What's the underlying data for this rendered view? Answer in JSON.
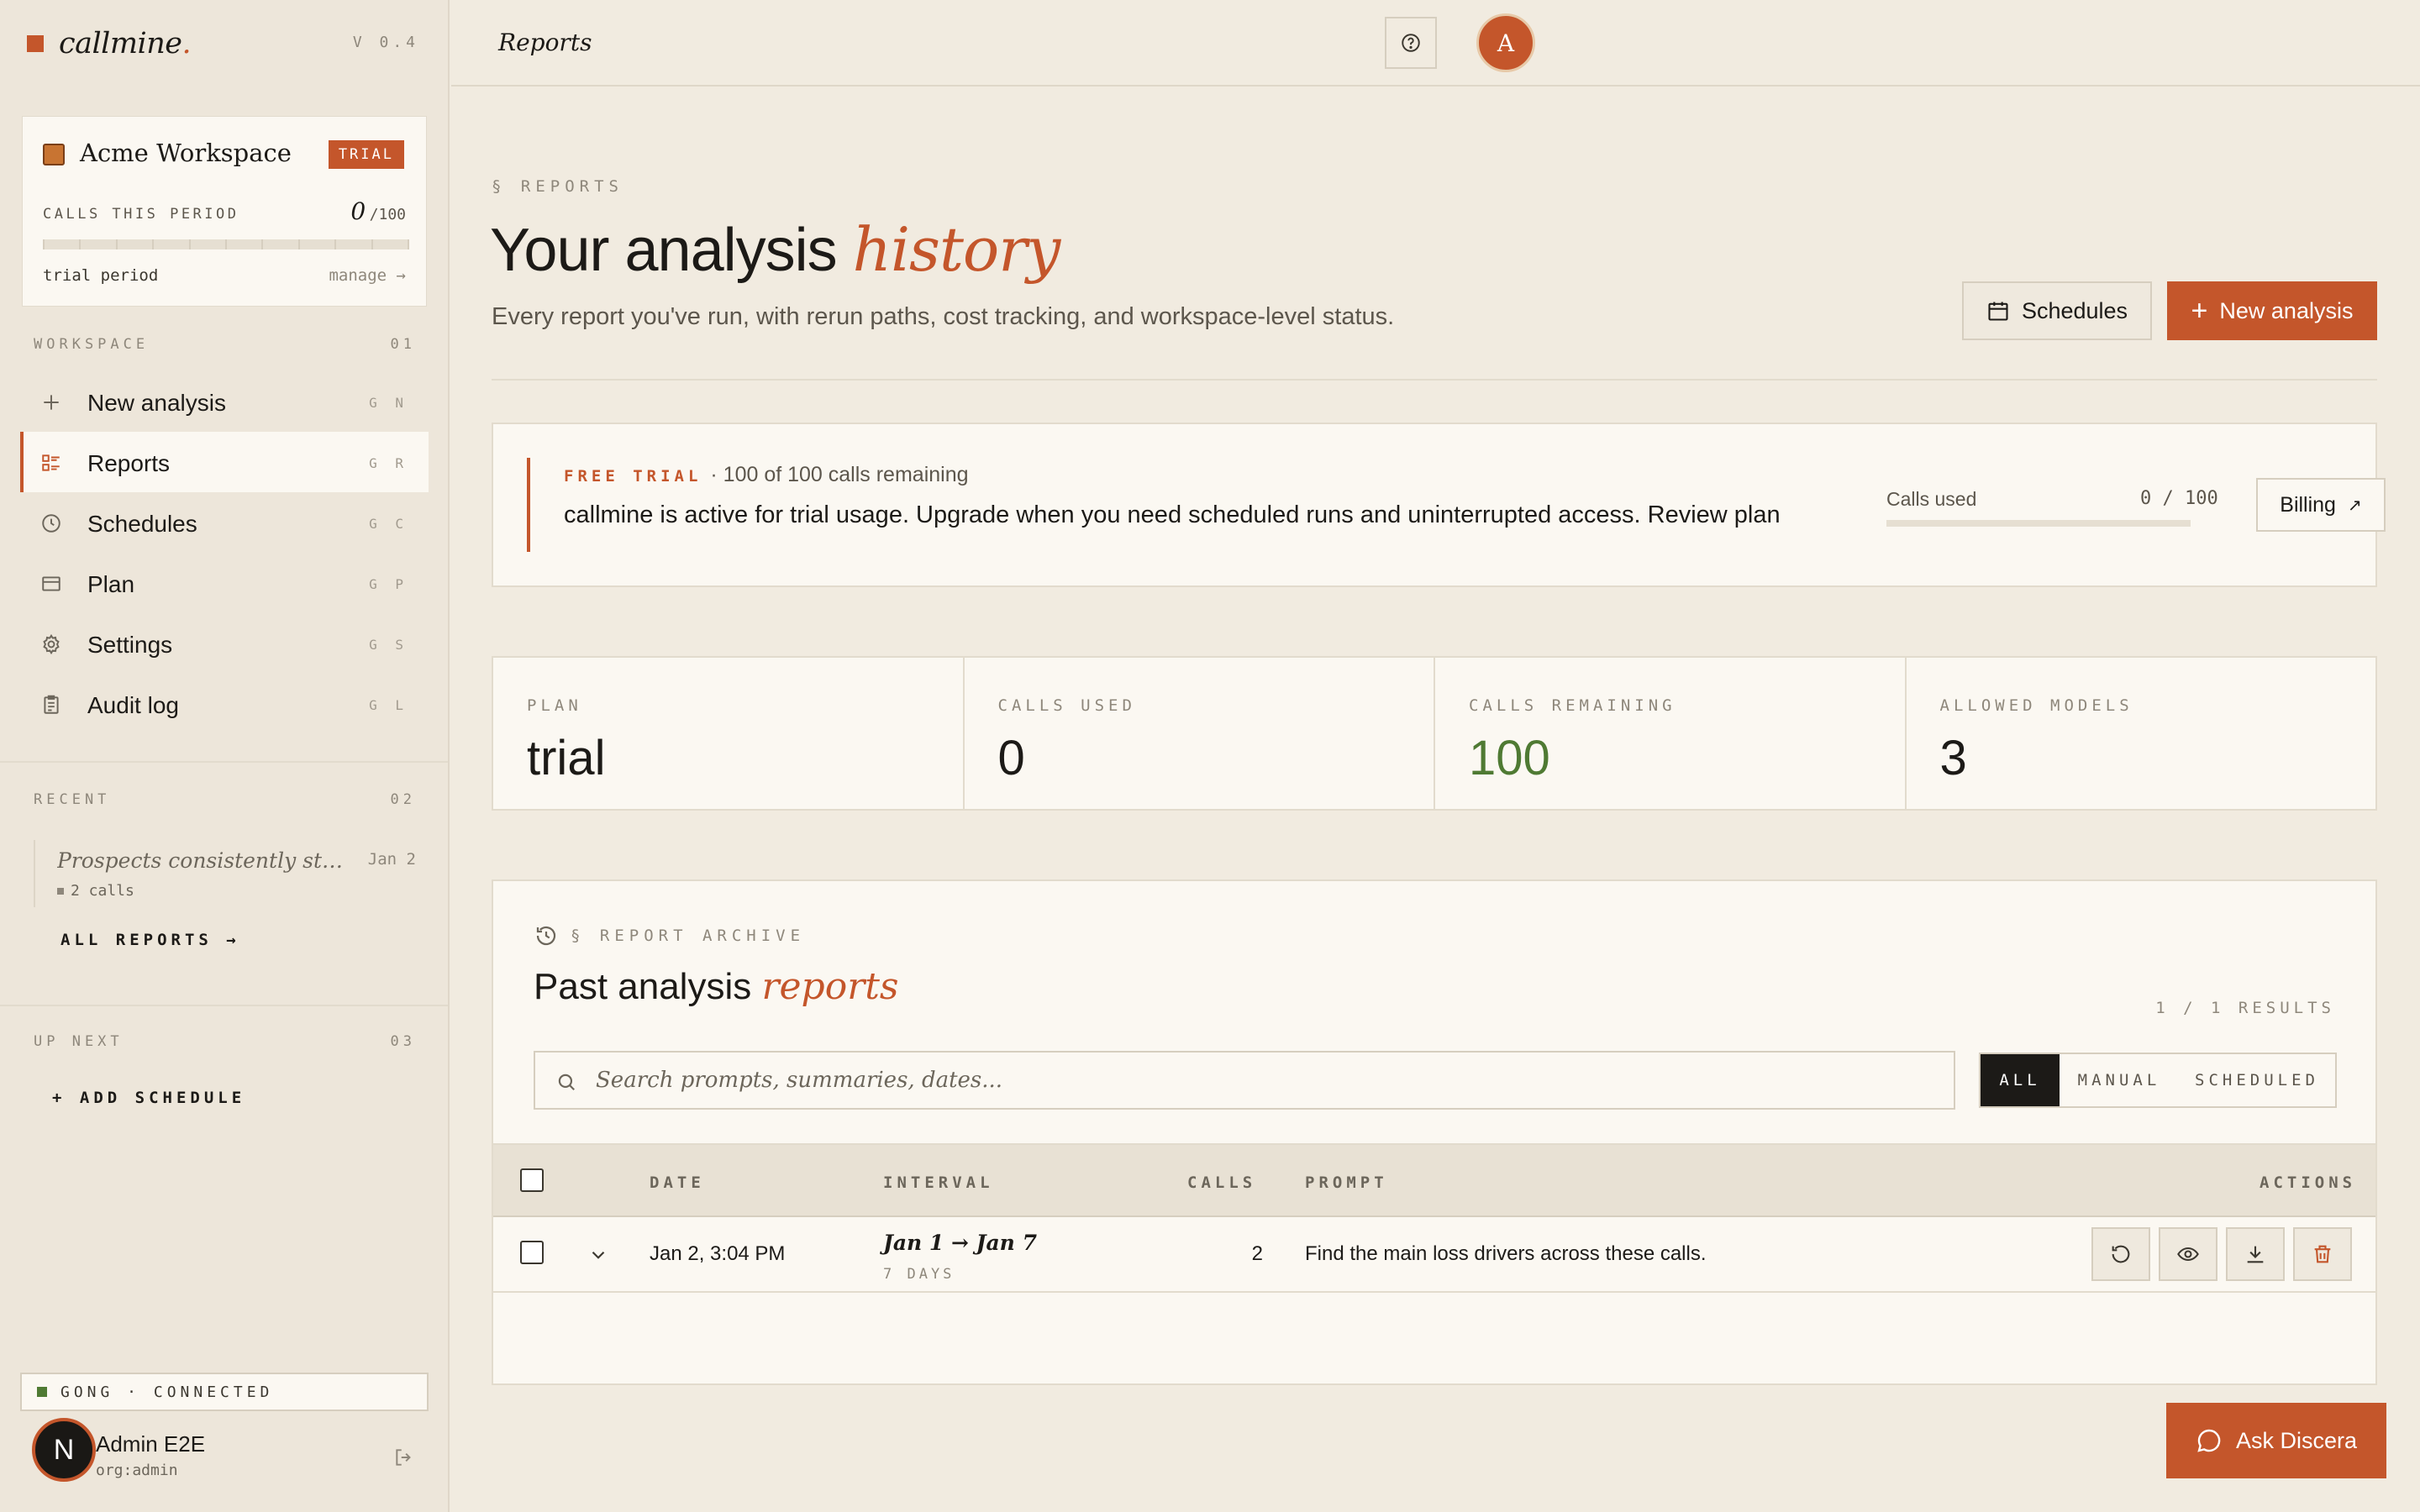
{
  "brand": {
    "name": "callmine",
    "dot": ".",
    "version": "V 0.4"
  },
  "workspace": {
    "name": "Acme Workspace",
    "badge": "TRIAL",
    "calls_label": "CALLS THIS PERIOD",
    "calls_used": "0",
    "calls_limit": "/100",
    "usage_fraction": 0,
    "period": "trial period",
    "manage": "manage →"
  },
  "sections": {
    "workspace": {
      "label": "WORKSPACE",
      "num": "01"
    },
    "recent": {
      "label": "RECENT",
      "num": "02"
    },
    "up_next": {
      "label": "UP NEXT",
      "num": "03"
    }
  },
  "nav": [
    {
      "label": "New analysis",
      "key": "G N",
      "icon": "plus-icon"
    },
    {
      "label": "Reports",
      "key": "G R",
      "icon": "list-icon",
      "active": true
    },
    {
      "label": "Schedules",
      "key": "G C",
      "icon": "clock-icon"
    },
    {
      "label": "Plan",
      "key": "G P",
      "icon": "card-icon"
    },
    {
      "label": "Settings",
      "key": "G S",
      "icon": "gear-icon"
    },
    {
      "label": "Audit log",
      "key": "G L",
      "icon": "clipboard-icon"
    }
  ],
  "recent": {
    "items": [
      {
        "title": "Prospects consistently stall at pricing",
        "date": "Jan 2",
        "meta": "2 calls"
      }
    ],
    "all_reports": "ALL REPORTS →"
  },
  "up_next": {
    "add_schedule": "+ ADD SCHEDULE"
  },
  "integration": {
    "status": "GONG · CONNECTED"
  },
  "user": {
    "initial": "N",
    "name": "Admin E2E",
    "org": "org:admin"
  },
  "topbar": {
    "breadcrumb": "Reports",
    "avatar_initial": "A"
  },
  "header": {
    "eyebrow": "§ REPORTS",
    "title_main": "Your analysis ",
    "title_accent": "history",
    "subtitle": "Every report you've run, with rerun paths, cost tracking, and workspace-level status.",
    "schedules_button": "Schedules",
    "new_analysis_button": "New analysis"
  },
  "trial_notice": {
    "tag": "FREE TRIAL",
    "remaining": "· 100 of 100 calls remaining",
    "message": "callmine is active for trial usage. Upgrade when you need scheduled runs and uninterrupted access. Review plan",
    "used_label": "Calls used",
    "used_value": "0 / 100",
    "used_fraction": 0,
    "billing_button": "Billing",
    "billing_arrow": "↗"
  },
  "stats": [
    {
      "label": "PLAN",
      "value": "trial"
    },
    {
      "label": "CALLS USED",
      "value": "0"
    },
    {
      "label": "CALLS REMAINING",
      "value": "100"
    },
    {
      "label": "ALLOWED MODELS",
      "value": "3"
    }
  ],
  "archive": {
    "eyebrow": "§ REPORT ARCHIVE",
    "title_main": "Past analysis ",
    "title_accent": "reports",
    "results": "1 / 1 RESULTS",
    "search_placeholder": "Search prompts, summaries, dates...",
    "filters": [
      "ALL",
      "MANUAL",
      "SCHEDULED"
    ],
    "columns": {
      "date": "DATE",
      "interval": "INTERVAL",
      "calls": "CALLS",
      "prompt": "PROMPT",
      "actions": "ACTIONS"
    },
    "rows": [
      {
        "date": "Jan 2, 3:04 PM",
        "interval": "Jan 1 → Jan 7",
        "interval_sub": "7 DAYS",
        "calls": "2",
        "prompt": "Find the main loss drivers across these calls."
      }
    ]
  },
  "assistant": {
    "label": "Ask Discera"
  },
  "colors": {
    "accent": "#c4562b",
    "background": "#f1ebe0",
    "panel": "#fbf8f2",
    "positive": "#4f7a33",
    "ink": "#1c1a17"
  }
}
